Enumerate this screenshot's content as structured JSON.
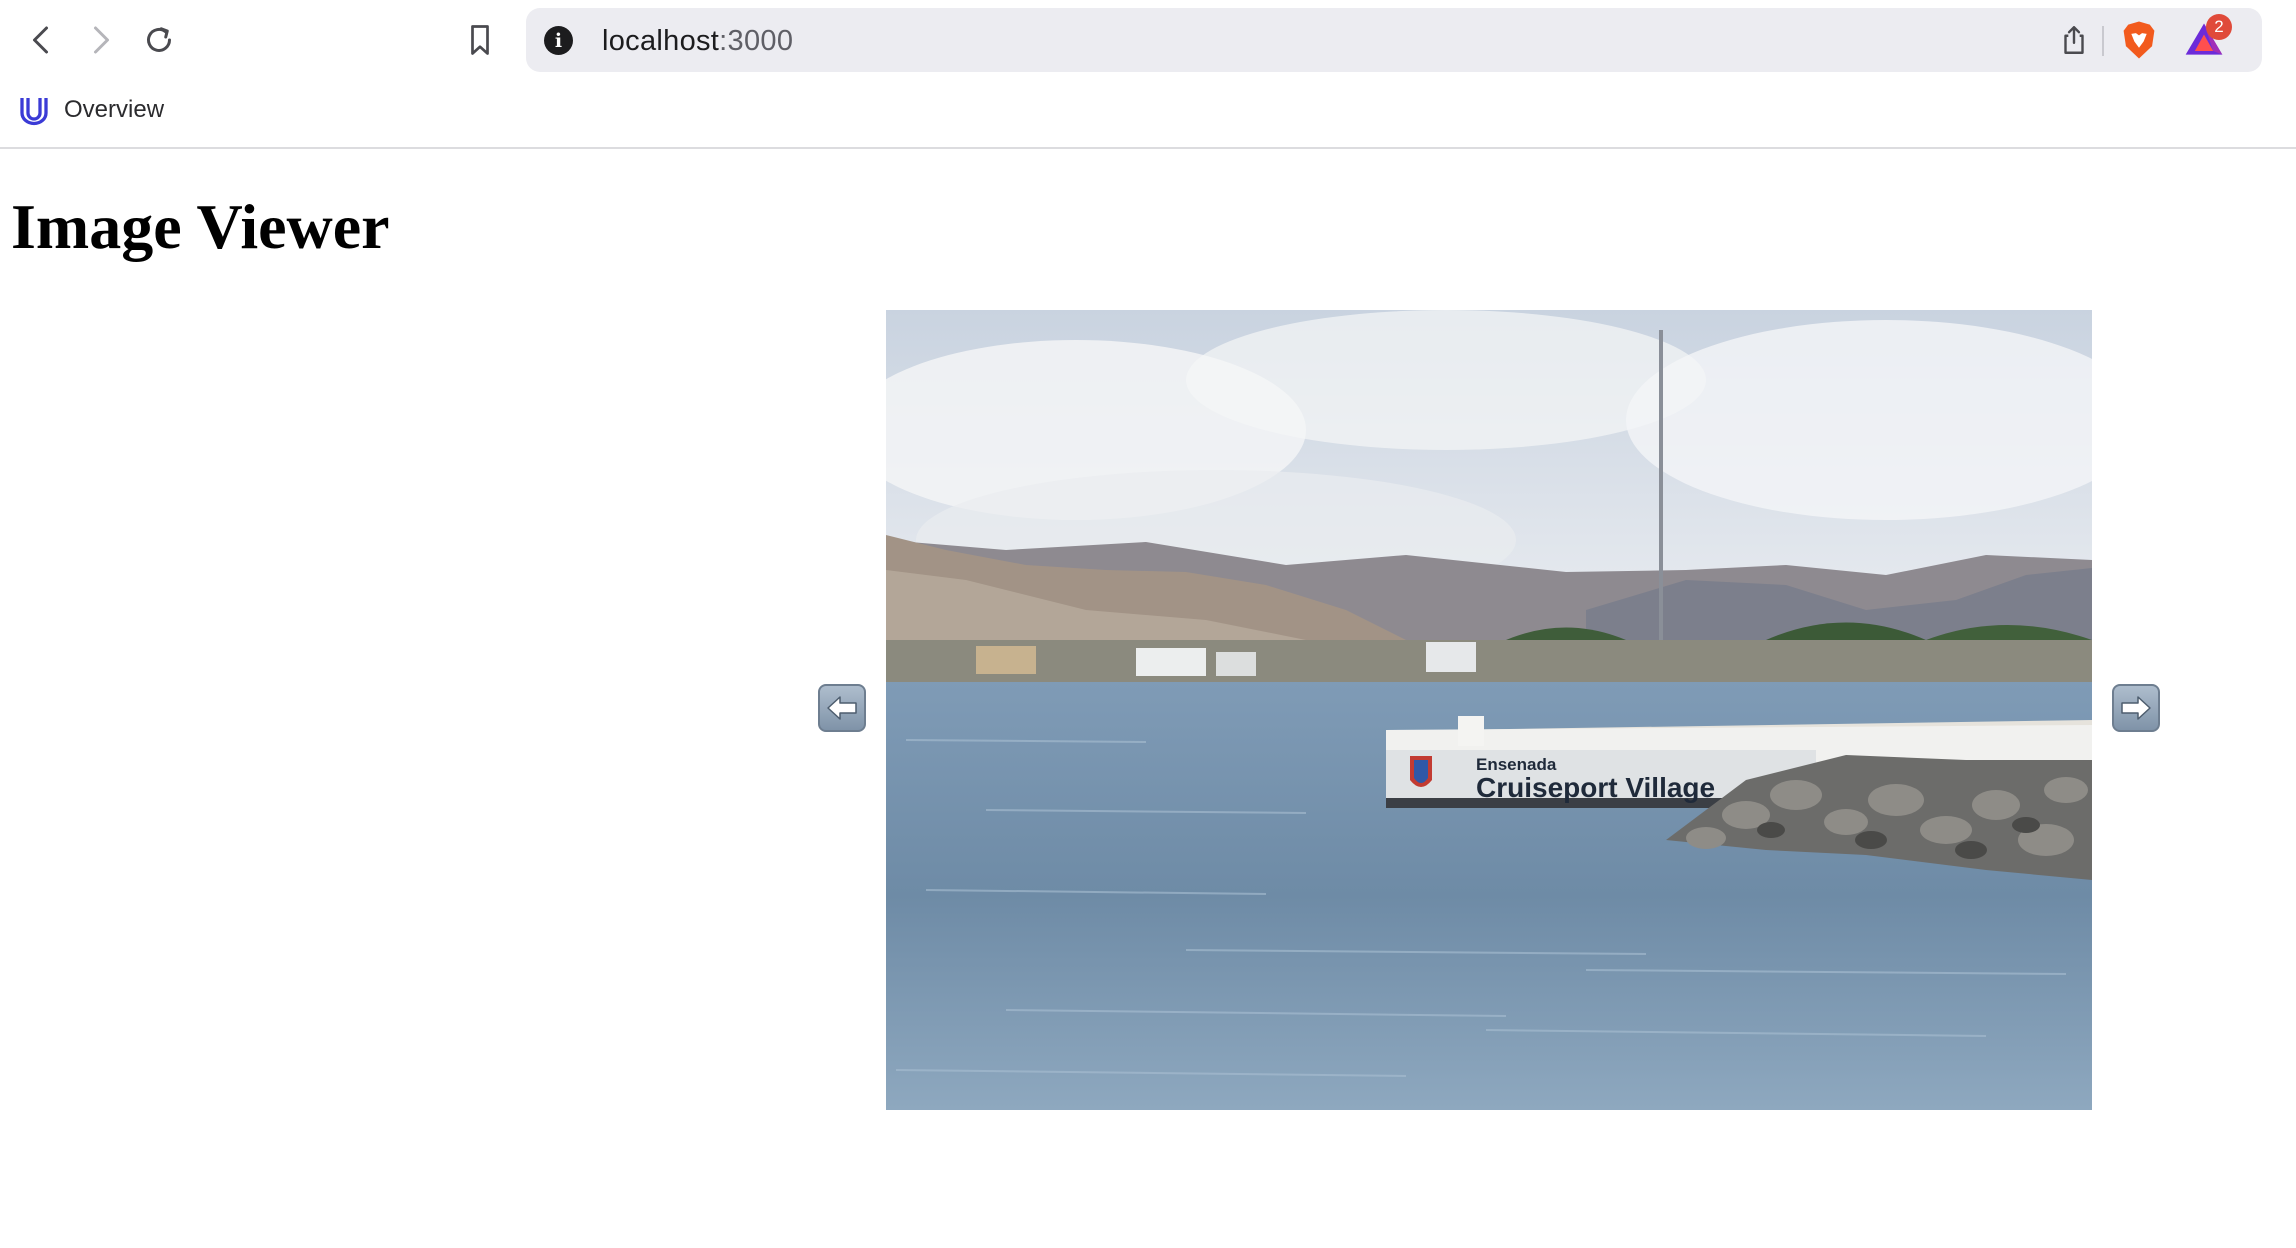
{
  "browser": {
    "url_host": "localhost",
    "url_port": ":3000",
    "notification_count": "2",
    "bookmark_label": "Overview",
    "icons": {
      "back": "chevron-left-icon",
      "forward": "chevron-right-icon",
      "reload": "reload-icon",
      "bookmark": "bookmark-icon",
      "info": "info-icon",
      "share": "share-icon",
      "brave": "brave-shield-icon",
      "rewards": "brave-rewards-icon"
    }
  },
  "page": {
    "title": "Image Viewer",
    "image": {
      "sign_line1": "Ensenada",
      "sign_line2": "Cruiseport Village"
    },
    "prev_icon": "arrow-left-icon",
    "next_icon": "arrow-right-icon"
  },
  "colors": {
    "accent_bookmark": "#3b3bd6",
    "arrow_button": "#8a9db2",
    "badge": "#e04a3a"
  }
}
